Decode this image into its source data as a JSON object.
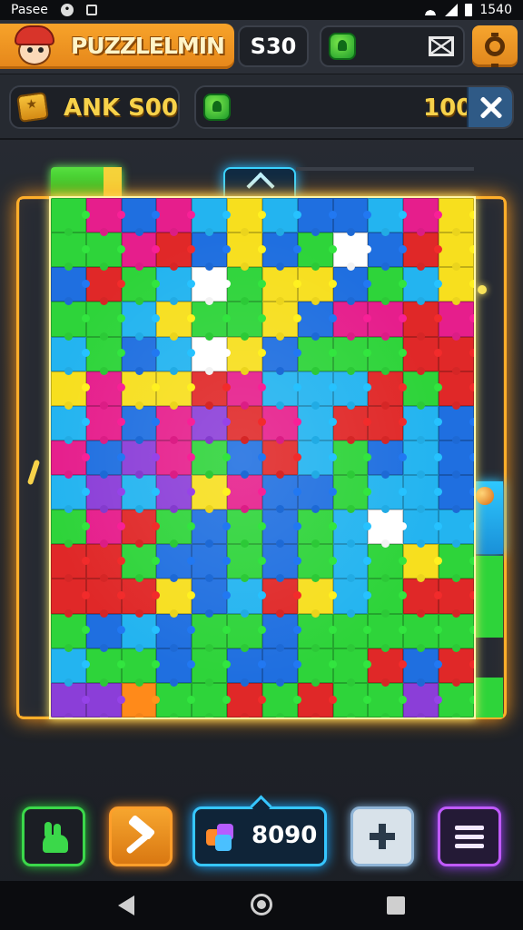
{
  "status_bar": {
    "left_text": "Pasee",
    "time": "1540"
  },
  "header": {
    "title": "PUZZLELMIN",
    "score": "S30",
    "colors": {
      "accent_orange": "#f29a24",
      "panel": "#2b2f37"
    }
  },
  "subheader": {
    "level_label": "ANK S00",
    "progress_value": "100"
  },
  "board": {
    "columns": 12,
    "rows": 15,
    "palette": [
      "#2ed43a",
      "#e61e8c",
      "#1f6fe0",
      "#f7df1e",
      "#e02828",
      "#23b4f0",
      "#8b3ed8",
      "#ffffff",
      "#ff8a1a"
    ],
    "cells": [
      [
        0,
        1,
        2,
        1,
        5,
        3,
        5,
        2,
        2,
        5,
        1,
        3
      ],
      [
        0,
        0,
        1,
        4,
        2,
        3,
        2,
        0,
        7,
        2,
        4,
        3
      ],
      [
        2,
        4,
        0,
        5,
        7,
        0,
        3,
        3,
        2,
        0,
        5,
        3
      ],
      [
        0,
        0,
        5,
        3,
        0,
        0,
        3,
        2,
        1,
        1,
        4,
        1
      ],
      [
        5,
        0,
        2,
        5,
        7,
        3,
        2,
        0,
        0,
        0,
        4,
        4
      ],
      [
        3,
        1,
        3,
        3,
        4,
        1,
        5,
        5,
        5,
        4,
        0,
        4
      ],
      [
        5,
        1,
        2,
        1,
        6,
        4,
        1,
        5,
        4,
        4,
        5,
        2
      ],
      [
        1,
        2,
        6,
        1,
        0,
        2,
        4,
        5,
        0,
        2,
        5,
        2
      ],
      [
        5,
        6,
        5,
        6,
        3,
        1,
        2,
        2,
        0,
        5,
        5,
        2
      ],
      [
        0,
        1,
        4,
        0,
        2,
        0,
        2,
        0,
        5,
        7,
        5,
        5
      ],
      [
        4,
        4,
        0,
        2,
        2,
        0,
        2,
        0,
        5,
        0,
        3,
        0
      ],
      [
        4,
        4,
        4,
        3,
        2,
        5,
        4,
        3,
        5,
        0,
        4,
        4
      ],
      [
        0,
        2,
        5,
        2,
        0,
        0,
        2,
        0,
        0,
        0,
        0,
        0
      ],
      [
        5,
        0,
        0,
        2,
        0,
        2,
        2,
        0,
        0,
        4,
        2,
        4
      ],
      [
        6,
        6,
        8,
        0,
        0,
        4,
        0,
        4,
        0,
        0,
        6,
        0
      ]
    ]
  },
  "toolbar": {
    "coins": "8090"
  },
  "icons": {
    "avatar": "chef-avatar-icon",
    "gem": "green-gem-icon",
    "mail": "envelope-icon",
    "settings": "gear-icon",
    "level": "puzzle-box-icon",
    "close": "close-icon",
    "hint": "rabbit-icon",
    "hammer": "hammer-icon",
    "coins": "coin-stack-icon",
    "plus": "plus-icon",
    "menu": "menu-icon"
  }
}
